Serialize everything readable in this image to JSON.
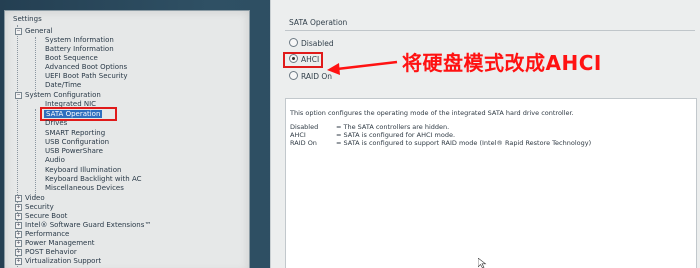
{
  "tree": {
    "root_label": "Settings",
    "items": [
      {
        "label": "General",
        "level": 1
      },
      {
        "label": "System Information",
        "level": 2
      },
      {
        "label": "Battery Information",
        "level": 2
      },
      {
        "label": "Boot Sequence",
        "level": 2
      },
      {
        "label": "Advanced Boot Options",
        "level": 2
      },
      {
        "label": "UEFI Boot Path Security",
        "level": 2
      },
      {
        "label": "Date/Time",
        "level": 2
      },
      {
        "label": "System Configuration",
        "level": 1
      },
      {
        "label": "Integrated NIC",
        "level": 2
      },
      {
        "label": "SATA Operation",
        "level": 2,
        "selected": true
      },
      {
        "label": "Drives",
        "level": 2
      },
      {
        "label": "SMART Reporting",
        "level": 2
      },
      {
        "label": "USB Configuration",
        "level": 2
      },
      {
        "label": "USB PowerShare",
        "level": 2
      },
      {
        "label": "Audio",
        "level": 2
      },
      {
        "label": "Keyboard Illumination",
        "level": 2
      },
      {
        "label": "Keyboard Backlight with AC",
        "level": 2
      },
      {
        "label": "Miscellaneous Devices",
        "level": 2
      },
      {
        "label": "Video",
        "level": 1
      },
      {
        "label": "Security",
        "level": 1
      },
      {
        "label": "Secure Boot",
        "level": 1
      },
      {
        "label": "Intel® Software Guard Extensions™",
        "level": 1
      },
      {
        "label": "Performance",
        "level": 1
      },
      {
        "label": "Power Management",
        "level": 1
      },
      {
        "label": "POST Behavior",
        "level": 1
      },
      {
        "label": "Virtualization Support",
        "level": 1
      }
    ]
  },
  "sata": {
    "group_title": "SATA Operation",
    "options": [
      "Disabled",
      "AHCI",
      "RAID On"
    ],
    "selected": "AHCI"
  },
  "annotation": {
    "text": "将硬盘模式改成AHCI",
    "color": "#ff1212"
  },
  "description": {
    "intro": "This option configures the operating mode of the integrated SATA hard drive controller.",
    "rows": [
      {
        "term": "Disabled",
        "text": "= The SATA controllers are hidden."
      },
      {
        "term": "AHCI",
        "text": "= SATA is configured for AHCI mode."
      },
      {
        "term": "RAID On",
        "text": "= SATA is configured to support RAID mode (Intel® Rapid Restore Technology)"
      }
    ]
  },
  "colors": {
    "highlight_red": "#e01a1a",
    "selection_blue": "#2f6fbf"
  }
}
